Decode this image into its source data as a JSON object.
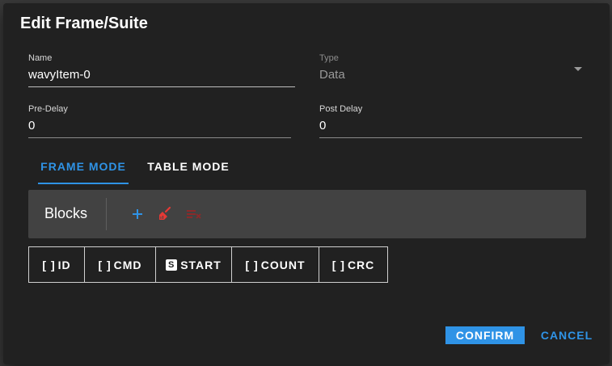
{
  "dialog": {
    "title": "Edit Frame/Suite"
  },
  "fields": {
    "name": {
      "label": "Name",
      "value": "wavyItem-0"
    },
    "type": {
      "label": "Type",
      "value": "Data"
    },
    "pre_delay": {
      "label": "Pre-Delay",
      "value": "0"
    },
    "post_delay": {
      "label": "Post Delay",
      "value": "0"
    }
  },
  "tabs": [
    {
      "label": "FRAME MODE",
      "active": true
    },
    {
      "label": "TABLE MODE",
      "active": false
    }
  ],
  "blocks": {
    "title": "Blocks",
    "icons": [
      "add-icon",
      "broom-icon",
      "clear-list-icon"
    ]
  },
  "chips": [
    {
      "icon": "[ ]",
      "label": "ID"
    },
    {
      "icon": "[ ]",
      "label": "CMD"
    },
    {
      "icon": "S",
      "label": "START"
    },
    {
      "icon": "[ ]",
      "label": "COUNT"
    },
    {
      "icon": "[ ]",
      "label": "CRC"
    }
  ],
  "actions": {
    "confirm": "CONFIRM",
    "cancel": "CANCEL"
  },
  "colors": {
    "accent": "#2f93e6",
    "danger": "#e53935",
    "danger_dim": "#8b2a2a",
    "dialog_bg": "#212121",
    "bar_bg": "#424242"
  }
}
